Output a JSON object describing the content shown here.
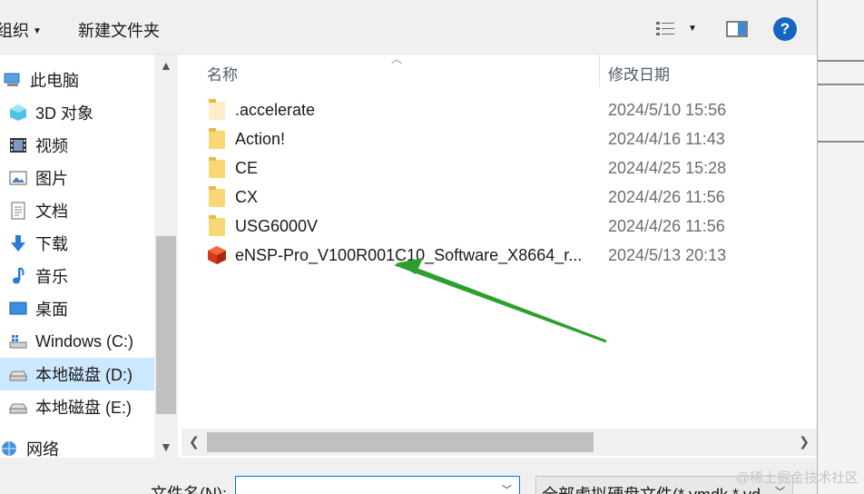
{
  "toolbar": {
    "organize_label": "组织",
    "new_folder_label": "新建文件夹"
  },
  "nav": {
    "items": [
      {
        "label": "此电脑",
        "icon": "computer-icon"
      },
      {
        "label": "3D 对象",
        "icon": "3d-objects-icon"
      },
      {
        "label": "视频",
        "icon": "video-icon"
      },
      {
        "label": "图片",
        "icon": "pictures-icon"
      },
      {
        "label": "文档",
        "icon": "documents-icon"
      },
      {
        "label": "下载",
        "icon": "download-icon"
      },
      {
        "label": "音乐",
        "icon": "music-icon"
      },
      {
        "label": "桌面",
        "icon": "desktop-icon"
      },
      {
        "label": "Windows (C:)",
        "icon": "drive-c-icon"
      },
      {
        "label": "本地磁盘 (D:)",
        "icon": "drive-icon",
        "selected": true
      },
      {
        "label": "本地磁盘 (E:)",
        "icon": "drive-icon"
      },
      {
        "label": "网络",
        "icon": "network-icon"
      }
    ]
  },
  "columns": {
    "name": "名称",
    "date": "修改日期"
  },
  "files": [
    {
      "name": ".accelerate",
      "date": "2024/5/10 15:56",
      "type": "folder-hidden"
    },
    {
      "name": "Action!",
      "date": "2024/4/16 11:43",
      "type": "folder"
    },
    {
      "name": "CE",
      "date": "2024/4/25 15:28",
      "type": "folder"
    },
    {
      "name": "CX",
      "date": "2024/4/26 11:56",
      "type": "folder"
    },
    {
      "name": "USG6000V",
      "date": "2024/4/26 11:56",
      "type": "folder"
    },
    {
      "name": "eNSP-Pro_V100R001C10_Software_X8664_r...",
      "date": "2024/5/13 20:13",
      "type": "package"
    }
  ],
  "bottom": {
    "filename_label": "文件名(N):",
    "filename_value": "",
    "filter_value": "全部虚拟硬盘文件(*.vmdk,*.vd"
  },
  "watermark": "@稀土掘金技术社区",
  "colors": {
    "accent": "#0078d7",
    "selected_bg": "#cce8ff",
    "arrow": "#2ca02c",
    "help": "#1565c0"
  }
}
